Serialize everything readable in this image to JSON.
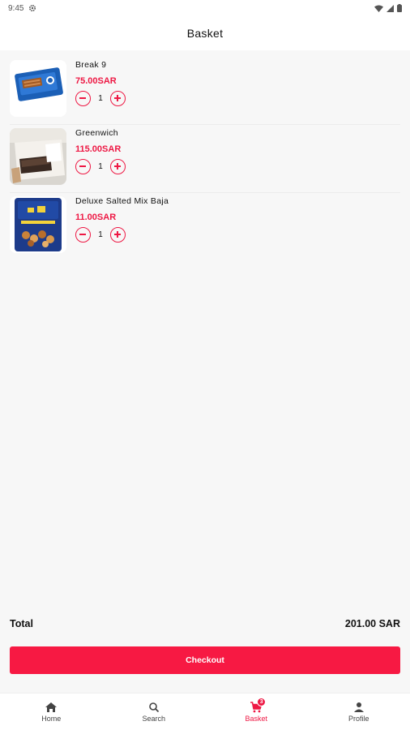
{
  "status_bar": {
    "time": "9:45"
  },
  "header": {
    "title": "Basket"
  },
  "items": [
    {
      "name": "Break  9",
      "price": "75.00SAR",
      "quantity": "1"
    },
    {
      "name": "Greenwich",
      "price": "115.00SAR",
      "quantity": "1"
    },
    {
      "name": "Deluxe Salted Mix Baja",
      "price": "11.00SAR",
      "quantity": "1"
    }
  ],
  "summary": {
    "total_label": "Total",
    "total_value": "201.00 SAR"
  },
  "checkout": {
    "label": "Checkout"
  },
  "nav": {
    "items": [
      {
        "label": "Home",
        "icon": "home-icon"
      },
      {
        "label": "Search",
        "icon": "search-icon"
      },
      {
        "label": "Basket",
        "icon": "cart-icon",
        "badge": "3"
      },
      {
        "label": "Profile",
        "icon": "person-icon"
      }
    ],
    "active": "Basket"
  },
  "colors": {
    "accent": "#ee1844",
    "button": "#f71943",
    "background": "#f7f7f7"
  }
}
